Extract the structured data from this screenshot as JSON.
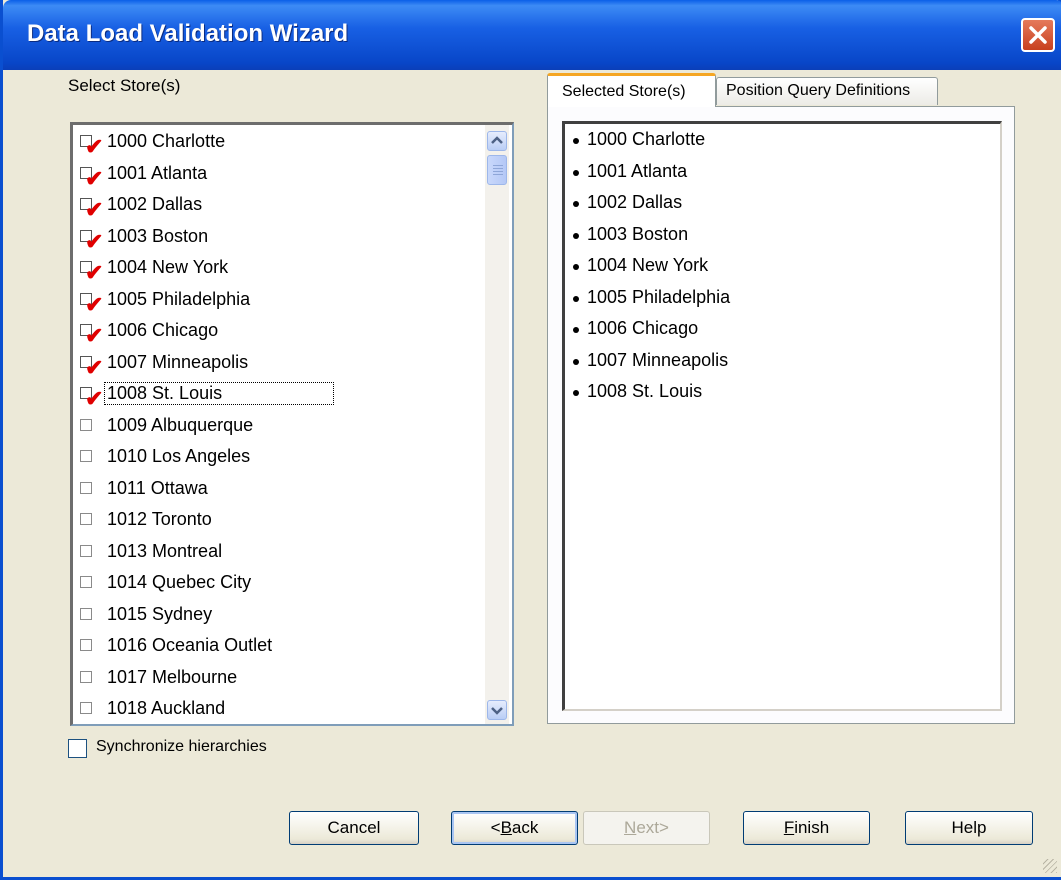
{
  "window": {
    "title": "Data Load Validation Wizard"
  },
  "left": {
    "label": "Select Store(s)",
    "stores": [
      {
        "name": "1000 Charlotte",
        "checked": true
      },
      {
        "name": "1001 Atlanta",
        "checked": true
      },
      {
        "name": "1002 Dallas",
        "checked": true
      },
      {
        "name": "1003 Boston",
        "checked": true
      },
      {
        "name": "1004 New York",
        "checked": true
      },
      {
        "name": "1005 Philadelphia",
        "checked": true
      },
      {
        "name": "1006 Chicago",
        "checked": true
      },
      {
        "name": "1007 Minneapolis",
        "checked": true
      },
      {
        "name": "1008 St. Louis",
        "checked": true,
        "focused": true
      },
      {
        "name": "1009 Albuquerque",
        "checked": false
      },
      {
        "name": "1010 Los Angeles",
        "checked": false
      },
      {
        "name": "1011 Ottawa",
        "checked": false
      },
      {
        "name": "1012 Toronto",
        "checked": false
      },
      {
        "name": "1013 Montreal",
        "checked": false
      },
      {
        "name": "1014 Quebec City",
        "checked": false
      },
      {
        "name": "1015 Sydney",
        "checked": false
      },
      {
        "name": "1016 Oceania Outlet",
        "checked": false
      },
      {
        "name": "1017 Melbourne",
        "checked": false
      },
      {
        "name": "1018 Auckland",
        "checked": false
      }
    ],
    "sync_label": "Synchronize hierarchies",
    "sync_checked": false
  },
  "tabs": [
    {
      "label": "Selected Store(s)",
      "active": true
    },
    {
      "label": "Position Query Definitions",
      "active": false
    }
  ],
  "selected_stores": [
    "1000 Charlotte",
    "1001 Atlanta",
    "1002 Dallas",
    "1003 Boston",
    "1004 New York",
    "1005 Philadelphia",
    "1006 Chicago",
    "1007 Minneapolis",
    "1008 St. Louis"
  ],
  "buttons": {
    "cancel": {
      "label": "Cancel",
      "mnemonic": ""
    },
    "back": {
      "label": "Back",
      "prefix": "<",
      "mnemonic": "B"
    },
    "next": {
      "label": "Next>",
      "mnemonic": "N",
      "enabled": false
    },
    "finish": {
      "label": "Finish",
      "mnemonic": "F"
    },
    "help": {
      "label": "Help",
      "mnemonic": ""
    }
  },
  "colors": {
    "title_bar": "#0a4fd0",
    "check_mark": "#e00000",
    "tab_accent": "#f5a623"
  }
}
